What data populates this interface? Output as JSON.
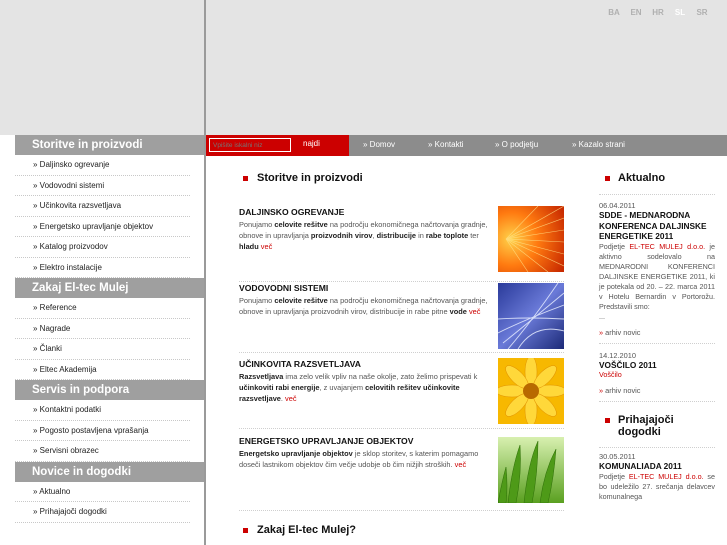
{
  "languages": [
    "BA",
    "EN",
    "HR",
    "SL",
    "SR"
  ],
  "active_language": "SL",
  "sidebar": {
    "sections": [
      {
        "title": "Storitve in proizvodi",
        "items": [
          "Daljinsko ogrevanje",
          "Vodovodni sistemi",
          "Učinkovita razsvetljava",
          "Energetsko upravljanje objektov",
          "Katalog proizvodov",
          "Elektro instalacije"
        ]
      },
      {
        "title": "Zakaj El-tec Mulej",
        "items": [
          "Reference",
          "Nagrade",
          "Članki",
          "Eltec Akademija"
        ]
      },
      {
        "title": "Servis in podpora",
        "items": [
          "Kontaktni podatki",
          "Pogosto postavljena vprašanja",
          "Servisni obrazec"
        ]
      },
      {
        "title": "Novice in dogodki",
        "items": [
          "Aktualno",
          "Prihajajoči dogodki"
        ]
      }
    ]
  },
  "search": {
    "placeholder": "Vpišite iskalni niz",
    "button": "najdi"
  },
  "nav": [
    "» Domov",
    "» Kontakti",
    "» O podjetju",
    "» Kazalo strani"
  ],
  "main": {
    "section1_title": "Storitve in proizvodi",
    "section2_title": "Zakaj El-tec Mulej?",
    "more_label": "več",
    "articles": [
      {
        "title": "DALJINSKO OGREVANJE"
      },
      {
        "title": "VODOVODNI SISTEMI"
      },
      {
        "title": "UČINKOVITA RAZSVETLJAVA"
      },
      {
        "title": "ENERGETSKO UPRAVLJANJE OBJEKTOV"
      }
    ],
    "text": {
      "a1_1": "Ponujamo ",
      "a1_2": "celovite rešitve",
      "a1_3": " na področju ekonomičnega načrtovanja gradnje, obnove in upravljanja ",
      "a1_4": "proizvodnih virov",
      "a1_5": ", ",
      "a1_6": "distribucije",
      "a1_7": " in ",
      "a1_8": "rabe toplote",
      "a1_9": " ter ",
      "a1_10": "hladu",
      "a2_1": "Ponujamo ",
      "a2_2": "celovite rešitve",
      "a2_3": " na področju ekonomičnega načrtovanja gradnje, obnove in upravljanja proizvodnih virov, distribucije in rabe pitne ",
      "a2_4": "vode",
      "a3_1": "Razsvetljava",
      "a3_2": " ima zelo velik vpliv na naše okolje, zato želimo prispevati k ",
      "a3_3": "učinkoviti rabi energije",
      "a3_4": ", z uvajanjem ",
      "a3_5": "celovitih rešitev učinkovite razsvetljave",
      "a4_1": "Energetsko upravljanje objektov",
      "a4_2": " je sklop storitev, s katerim pomagamo doseči lastnikom objektov čim večje udobje ob čim nižjih stroških."
    }
  },
  "right": {
    "aktualno_title": "Aktualno",
    "news1": {
      "date": "06.04.2011",
      "title": "SDDE - MEDNARODNA KONFERENCA DALJINSKE ENERGETIKE 2011",
      "t1": "Podjetje ",
      "t2": "EL-TEC MULEJ d.o.o.",
      "t3": " je aktivno sodelovalo na MEDNARODNI KONFERENCI DALJINSKE ENERGETIKE 2011, ki je potekala od 20. – 22. marca 2011 v Hotelu Bernardin v Portorožu. Predstavili smo:",
      "t4": "..."
    },
    "arhiv": "arhiv novic",
    "news2": {
      "date": "14.12.2010",
      "title": "VOŠČILO 2011",
      "text": "Voščilo"
    },
    "dogodki_title": "Prihajajoči dogodki",
    "event1": {
      "date": "30.05.2011",
      "title": "KOMUNALIADA 2011",
      "t1": "Podjetje ",
      "t2": "EL-TEC MULEJ d.o.o.",
      "t3": " se bo udeležilo 27. srečanja delavcev komunalnega"
    }
  },
  "colors": {
    "accent": "#cc0000",
    "sidebar_header": "#9f9f9f",
    "nav": "#8c8c8c",
    "background_top": "#e4e4e4"
  },
  "images": [
    "orange-fibers-photo",
    "blue-fibers-photo",
    "yellow-flower-photo",
    "green-leaves-photo"
  ]
}
